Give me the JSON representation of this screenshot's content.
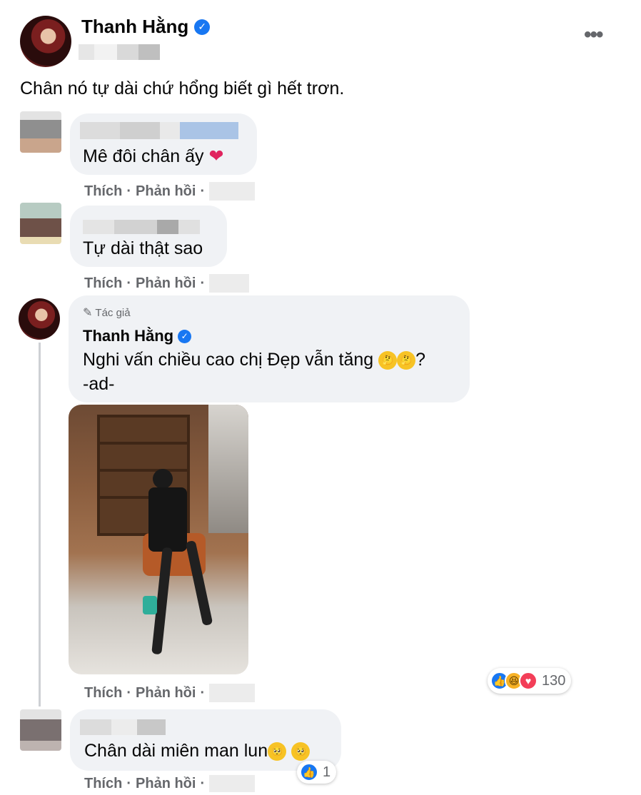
{
  "post": {
    "author": "Thanh Hằng",
    "verified_icon": "✓",
    "more_icon": "•••",
    "text": "Chân nó tự dài chứ hổng biết gì hết trơn."
  },
  "comments": [
    {
      "text": "Mê đôi chân ấy",
      "emoji": "❤️",
      "like_label": "Thích",
      "reply_label": "Phản hồi",
      "sep": "·"
    },
    {
      "text": "Tự dài thật sao",
      "like_label": "Thích",
      "reply_label": "Phản hồi",
      "sep": "·"
    },
    {
      "author_tag": "Tác giả",
      "author": "Thanh Hằng",
      "line1": "Nghi vấn chiều cao chị Đẹp vẫn tăng",
      "line1_tail": "?",
      "line2": "-ad-",
      "like_label": "Thích",
      "reply_label": "Phản hồi",
      "sep": "·",
      "reaction_count": "130"
    },
    {
      "text": "Chân dài miên man lun",
      "like_label": "Thích",
      "reply_label": "Phản hồi",
      "sep": "·",
      "reaction_count": "1"
    }
  ],
  "colors": {
    "bubble": "#f0f2f5",
    "muted": "#65676b",
    "brand": "#1877f2"
  }
}
